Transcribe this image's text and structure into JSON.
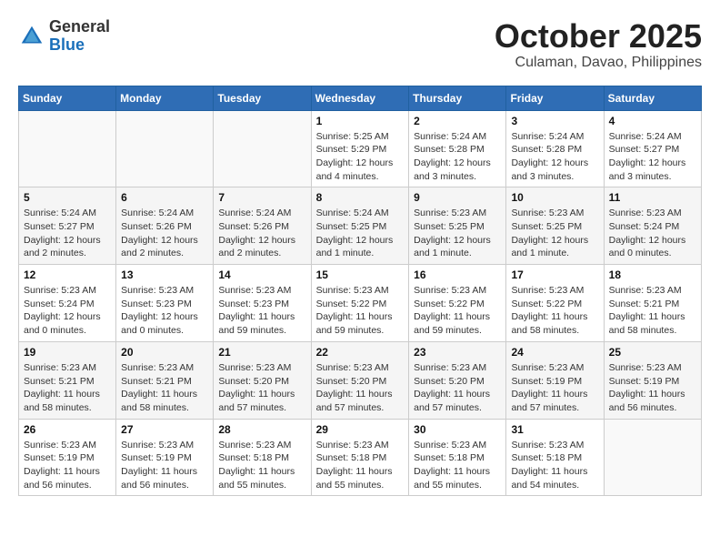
{
  "header": {
    "logo_general": "General",
    "logo_blue": "Blue",
    "month_year": "October 2025",
    "location": "Culaman, Davao, Philippines"
  },
  "days_of_week": [
    "Sunday",
    "Monday",
    "Tuesday",
    "Wednesday",
    "Thursday",
    "Friday",
    "Saturday"
  ],
  "weeks": [
    [
      {
        "day": "",
        "info": ""
      },
      {
        "day": "",
        "info": ""
      },
      {
        "day": "",
        "info": ""
      },
      {
        "day": "1",
        "info": "Sunrise: 5:25 AM\nSunset: 5:29 PM\nDaylight: 12 hours\nand 4 minutes."
      },
      {
        "day": "2",
        "info": "Sunrise: 5:24 AM\nSunset: 5:28 PM\nDaylight: 12 hours\nand 3 minutes."
      },
      {
        "day": "3",
        "info": "Sunrise: 5:24 AM\nSunset: 5:28 PM\nDaylight: 12 hours\nand 3 minutes."
      },
      {
        "day": "4",
        "info": "Sunrise: 5:24 AM\nSunset: 5:27 PM\nDaylight: 12 hours\nand 3 minutes."
      }
    ],
    [
      {
        "day": "5",
        "info": "Sunrise: 5:24 AM\nSunset: 5:27 PM\nDaylight: 12 hours\nand 2 minutes."
      },
      {
        "day": "6",
        "info": "Sunrise: 5:24 AM\nSunset: 5:26 PM\nDaylight: 12 hours\nand 2 minutes."
      },
      {
        "day": "7",
        "info": "Sunrise: 5:24 AM\nSunset: 5:26 PM\nDaylight: 12 hours\nand 2 minutes."
      },
      {
        "day": "8",
        "info": "Sunrise: 5:24 AM\nSunset: 5:25 PM\nDaylight: 12 hours\nand 1 minute."
      },
      {
        "day": "9",
        "info": "Sunrise: 5:23 AM\nSunset: 5:25 PM\nDaylight: 12 hours\nand 1 minute."
      },
      {
        "day": "10",
        "info": "Sunrise: 5:23 AM\nSunset: 5:25 PM\nDaylight: 12 hours\nand 1 minute."
      },
      {
        "day": "11",
        "info": "Sunrise: 5:23 AM\nSunset: 5:24 PM\nDaylight: 12 hours\nand 0 minutes."
      }
    ],
    [
      {
        "day": "12",
        "info": "Sunrise: 5:23 AM\nSunset: 5:24 PM\nDaylight: 12 hours\nand 0 minutes."
      },
      {
        "day": "13",
        "info": "Sunrise: 5:23 AM\nSunset: 5:23 PM\nDaylight: 12 hours\nand 0 minutes."
      },
      {
        "day": "14",
        "info": "Sunrise: 5:23 AM\nSunset: 5:23 PM\nDaylight: 11 hours\nand 59 minutes."
      },
      {
        "day": "15",
        "info": "Sunrise: 5:23 AM\nSunset: 5:22 PM\nDaylight: 11 hours\nand 59 minutes."
      },
      {
        "day": "16",
        "info": "Sunrise: 5:23 AM\nSunset: 5:22 PM\nDaylight: 11 hours\nand 59 minutes."
      },
      {
        "day": "17",
        "info": "Sunrise: 5:23 AM\nSunset: 5:22 PM\nDaylight: 11 hours\nand 58 minutes."
      },
      {
        "day": "18",
        "info": "Sunrise: 5:23 AM\nSunset: 5:21 PM\nDaylight: 11 hours\nand 58 minutes."
      }
    ],
    [
      {
        "day": "19",
        "info": "Sunrise: 5:23 AM\nSunset: 5:21 PM\nDaylight: 11 hours\nand 58 minutes."
      },
      {
        "day": "20",
        "info": "Sunrise: 5:23 AM\nSunset: 5:21 PM\nDaylight: 11 hours\nand 58 minutes."
      },
      {
        "day": "21",
        "info": "Sunrise: 5:23 AM\nSunset: 5:20 PM\nDaylight: 11 hours\nand 57 minutes."
      },
      {
        "day": "22",
        "info": "Sunrise: 5:23 AM\nSunset: 5:20 PM\nDaylight: 11 hours\nand 57 minutes."
      },
      {
        "day": "23",
        "info": "Sunrise: 5:23 AM\nSunset: 5:20 PM\nDaylight: 11 hours\nand 57 minutes."
      },
      {
        "day": "24",
        "info": "Sunrise: 5:23 AM\nSunset: 5:19 PM\nDaylight: 11 hours\nand 57 minutes."
      },
      {
        "day": "25",
        "info": "Sunrise: 5:23 AM\nSunset: 5:19 PM\nDaylight: 11 hours\nand 56 minutes."
      }
    ],
    [
      {
        "day": "26",
        "info": "Sunrise: 5:23 AM\nSunset: 5:19 PM\nDaylight: 11 hours\nand 56 minutes."
      },
      {
        "day": "27",
        "info": "Sunrise: 5:23 AM\nSunset: 5:19 PM\nDaylight: 11 hours\nand 56 minutes."
      },
      {
        "day": "28",
        "info": "Sunrise: 5:23 AM\nSunset: 5:18 PM\nDaylight: 11 hours\nand 55 minutes."
      },
      {
        "day": "29",
        "info": "Sunrise: 5:23 AM\nSunset: 5:18 PM\nDaylight: 11 hours\nand 55 minutes."
      },
      {
        "day": "30",
        "info": "Sunrise: 5:23 AM\nSunset: 5:18 PM\nDaylight: 11 hours\nand 55 minutes."
      },
      {
        "day": "31",
        "info": "Sunrise: 5:23 AM\nSunset: 5:18 PM\nDaylight: 11 hours\nand 54 minutes."
      },
      {
        "day": "",
        "info": ""
      }
    ]
  ]
}
